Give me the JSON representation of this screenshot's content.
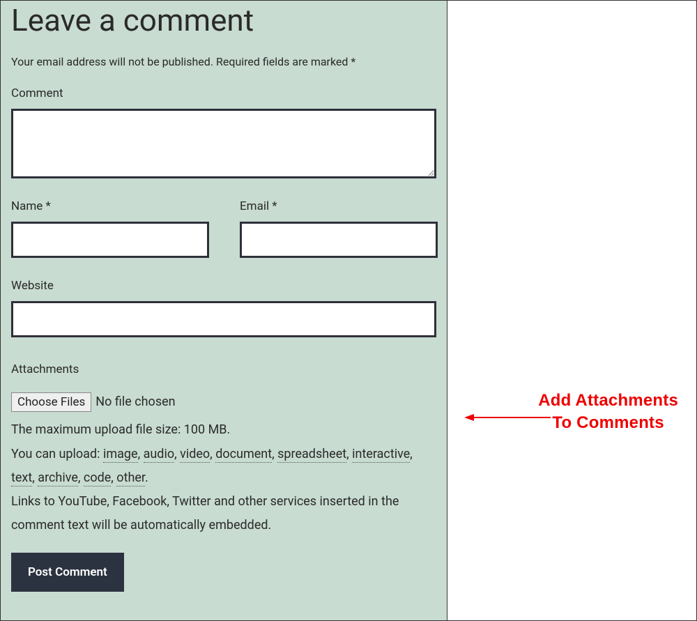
{
  "form": {
    "title": "Leave a comment",
    "notice": "Your email address will not be published. Required fields are marked *",
    "comment_label": "Comment",
    "name_label": "Name *",
    "email_label": "Email *",
    "website_label": "Website",
    "submit_label": "Post Comment"
  },
  "attachments": {
    "label": "Attachments",
    "choose_button": "Choose Files",
    "file_status": "No file chosen",
    "max_size_text": "The maximum upload file size: 100 MB.",
    "upload_prefix": "You can upload: ",
    "types": {
      "image": "image",
      "audio": "audio",
      "video": "video",
      "document": "document",
      "spreadsheet": "spreadsheet",
      "interactive": "interactive",
      "text": "text",
      "archive": "archive",
      "code": "code",
      "other": "other"
    },
    "sep": ", ",
    "links_text": "Links to YouTube, Facebook, Twitter and other services inserted in the comment text will be automatically embedded."
  },
  "annotation": {
    "line1": "Add Attachments",
    "line2": "To Comments"
  }
}
